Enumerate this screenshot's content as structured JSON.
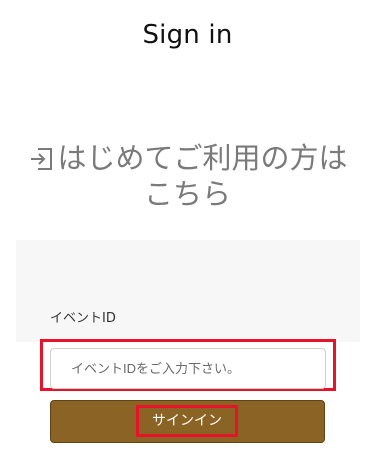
{
  "header": {
    "title": "Sign in"
  },
  "first_time": {
    "icon": "login-icon",
    "label": "はじめてご利用の方はこちら"
  },
  "form": {
    "event_id_label": "イベントID",
    "event_id_value": "",
    "event_id_placeholder": "イベントIDをご入力下さい。",
    "submit_label": "サインイン"
  },
  "colors": {
    "button_bg": "#8b6425",
    "highlight": "#e8132a",
    "muted_text": "#7a7a7a"
  }
}
